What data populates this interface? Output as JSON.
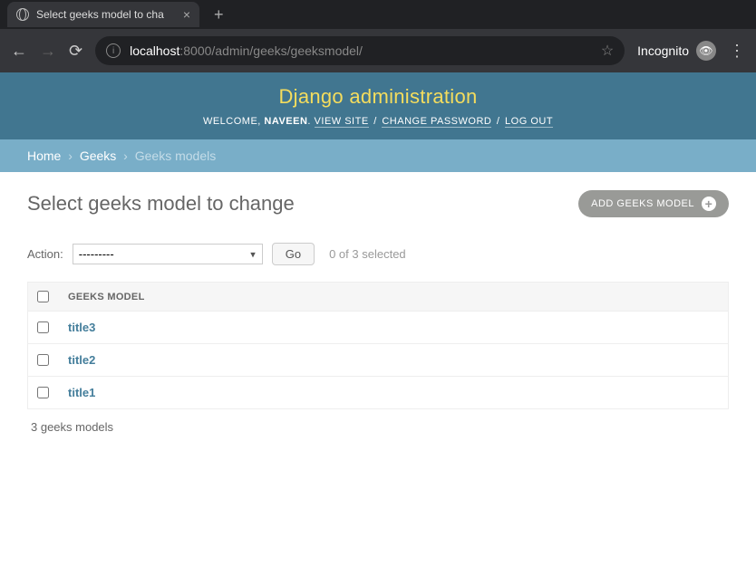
{
  "browser": {
    "tab_title": "Select geeks model to cha",
    "url_host": "localhost",
    "url_rest": ":8000/admin/geeks/geeksmodel/",
    "incognito_label": "Incognito"
  },
  "header": {
    "title": "Django administration",
    "welcome": "WELCOME, ",
    "username": "NAVEEN",
    "view_site": "VIEW SITE",
    "change_password": "CHANGE PASSWORD",
    "logout": "LOG OUT"
  },
  "breadcrumbs": {
    "home": "Home",
    "app": "Geeks",
    "model": "Geeks models"
  },
  "content": {
    "title": "Select geeks model to change",
    "add_label": "ADD GEEKS MODEL"
  },
  "actions": {
    "label": "Action:",
    "placeholder": "---------",
    "go": "Go",
    "selection": "0 of 3 selected"
  },
  "table": {
    "column_header": "GEEKS MODEL",
    "rows": [
      "title3",
      "title2",
      "title1"
    ]
  },
  "paginator": {
    "summary": "3 geeks models"
  }
}
